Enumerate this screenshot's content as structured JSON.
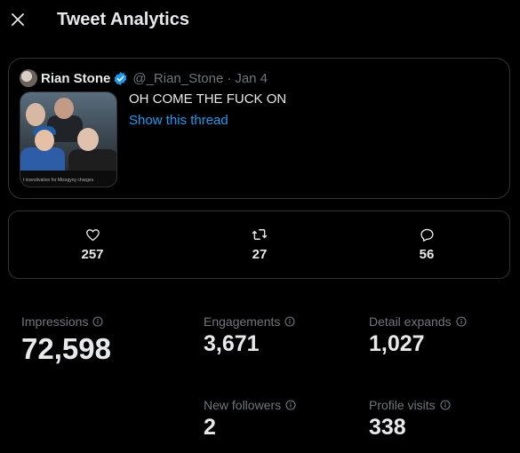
{
  "header": {
    "title": "Tweet Analytics",
    "close_icon": "close-icon"
  },
  "tweet": {
    "author": "Rian Stone",
    "handle": "@_Rian_Stone",
    "separator": "·",
    "date": "Jan 4",
    "text": "OH COME THE FUCK ON",
    "show_thread": "Show this thread",
    "media_caption": "t investivation for Misogyny charges"
  },
  "engagement": {
    "likes": "257",
    "retweets": "27",
    "replies": "56"
  },
  "metrics": {
    "impressions": {
      "label": "Impressions",
      "value": "72,598"
    },
    "engagements": {
      "label": "Engagements",
      "value": "3,671"
    },
    "detail_expands": {
      "label": "Detail expands",
      "value": "1,027"
    },
    "new_followers": {
      "label": "New followers",
      "value": "2"
    },
    "profile_visits": {
      "label": "Profile visits",
      "value": "338"
    }
  },
  "colors": {
    "background": "#000000",
    "text": "#e7e9ea",
    "muted": "#71767b",
    "accent": "#1d9bf0",
    "border": "#2f3336"
  }
}
